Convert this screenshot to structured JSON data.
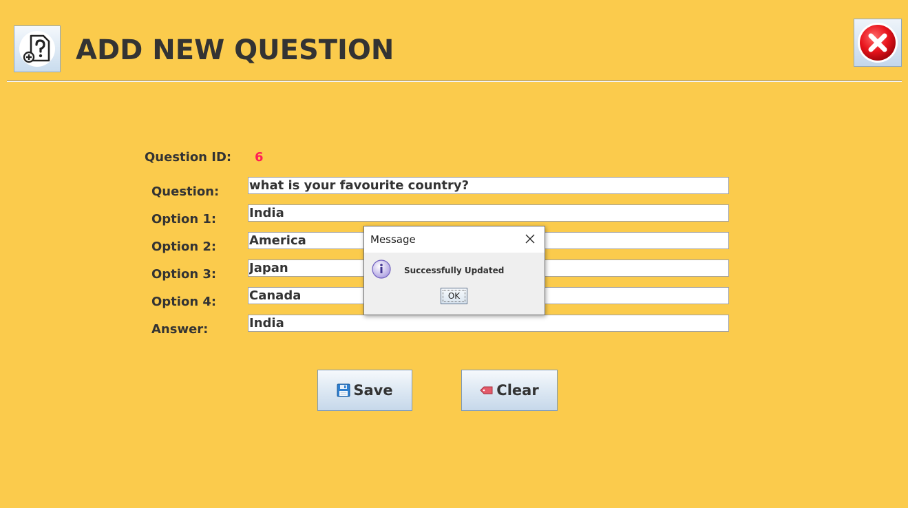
{
  "header": {
    "title": "ADD NEW QUESTION",
    "app_icon": "question-file-add-icon",
    "close_icon": "red-close-icon"
  },
  "form": {
    "question_id_label": "Question ID:",
    "question_id_value": "6",
    "question_label": "Question:",
    "question_value": "what is your favourite country?",
    "option1_label": "Option 1:",
    "option1_value": "India",
    "option2_label": "Option 2:",
    "option2_value": "America",
    "option3_label": "Option 3:",
    "option3_value": "Japan",
    "option4_label": "Option 4:",
    "option4_value": "Canada",
    "answer_label": "Answer:",
    "answer_value": "India"
  },
  "buttons": {
    "save_label": "Save",
    "save_icon": "floppy-disk-icon",
    "clear_label": "Clear",
    "clear_icon": "eraser-icon"
  },
  "dialog": {
    "title": "Message",
    "message": "Successfully Updated",
    "ok_label": "OK",
    "info_icon": "info-icon"
  },
  "colors": {
    "background": "#fbcb4c",
    "question_id_value": "#ff1e55",
    "close_red": "#e8141c"
  }
}
